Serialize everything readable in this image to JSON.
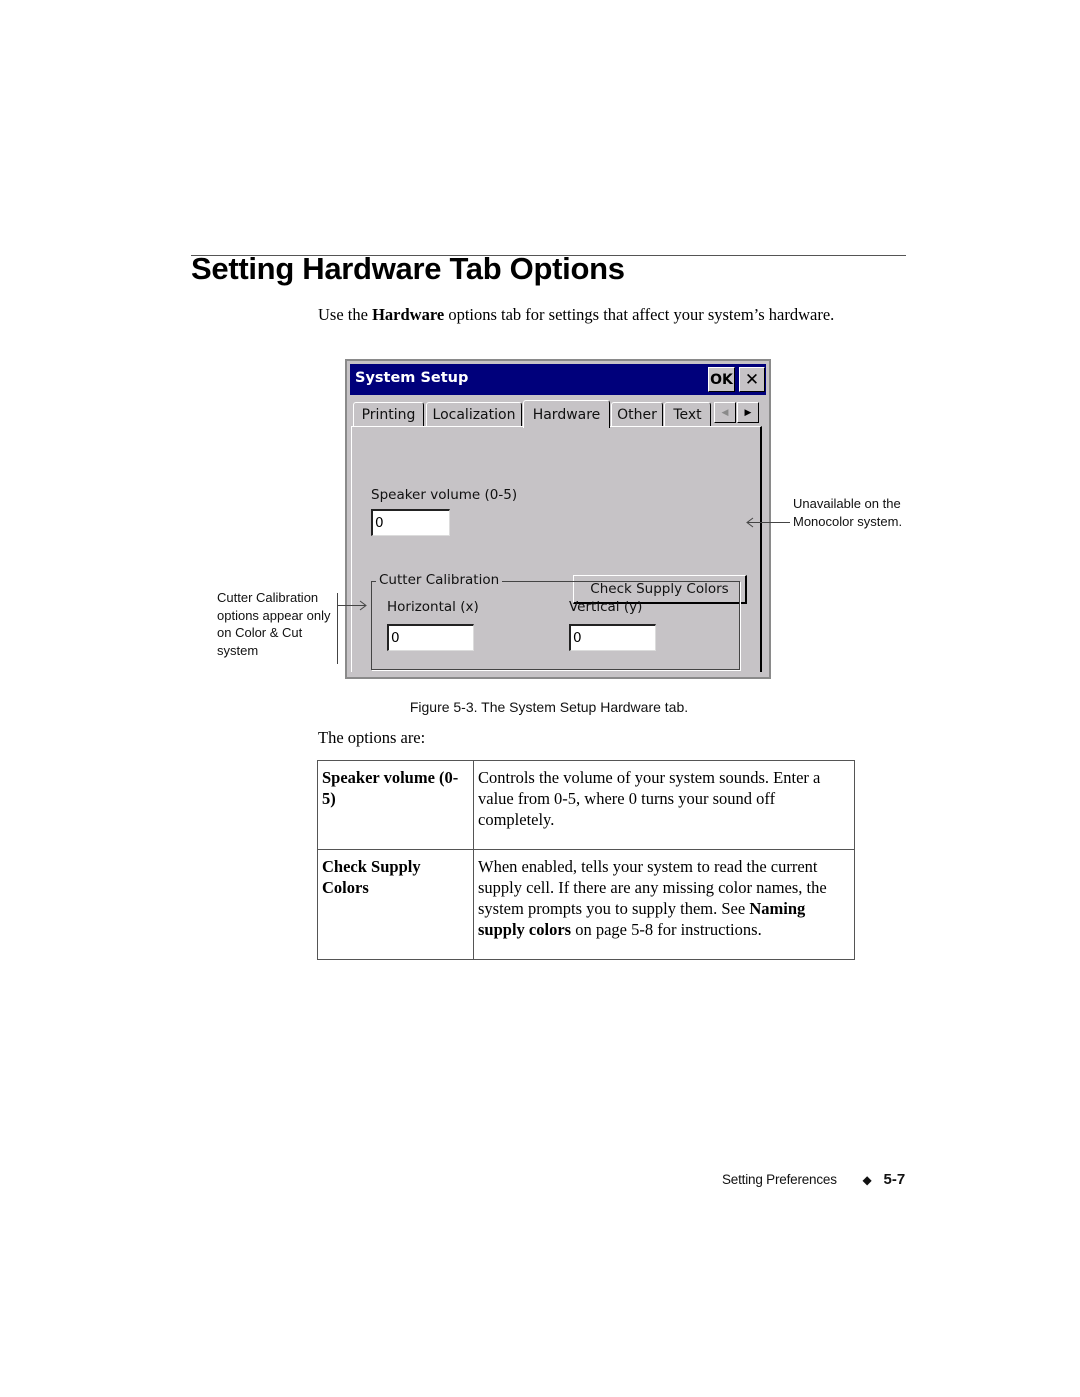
{
  "page": {
    "title": "Setting Hardware Tab Options",
    "intro_before": "Use the ",
    "intro_bold": "Hardware",
    "intro_after": " options tab for settings that affect your system’s hardware."
  },
  "window": {
    "title": "System Setup",
    "ok_label": "OK",
    "close_glyph": "✕",
    "tabs": [
      {
        "label": "Printing",
        "active": false
      },
      {
        "label": "Localization",
        "active": false
      },
      {
        "label": "Hardware",
        "active": true
      },
      {
        "label": "Other",
        "active": false
      },
      {
        "label": "Text",
        "active": false
      }
    ],
    "scroll_left_glyph": "◀",
    "scroll_right_glyph": "▶",
    "speaker_volume": {
      "label": "Speaker volume (0-5)",
      "value": "0"
    },
    "check_supply_colors_label": "Check Supply Colors",
    "cutter_calibration": {
      "legend": "Cutter Calibration",
      "horizontal": {
        "label": "Horizontal (x)",
        "value": "0"
      },
      "vertical": {
        "label": "Vertical (y)",
        "value": "0"
      }
    }
  },
  "callouts": {
    "left": "Cutter Calibration options appear only on Color & Cut system",
    "right": "Unavailable on the Monocolor system."
  },
  "figure_caption": "Figure 5-3. The System Setup Hardware tab.",
  "options_intro": "The options are:",
  "options": [
    {
      "term": "Speaker volume (0-5)",
      "desc_before": "Controls the volume of your system sounds. Enter a value from 0-5, where 0 turns your sound off completely.",
      "desc_bold": "",
      "desc_after": ""
    },
    {
      "term": "Check Supply Colors",
      "desc_before": "When enabled, tells your system to read the current supply cell. If there are any missing color names, the system prompts you to supply them. See ",
      "desc_bold": "Naming supply colors",
      "desc_after": " on page 5-8 for instructions."
    }
  ],
  "footer": {
    "section": "Setting Preferences",
    "diamond_glyph": "◆",
    "page_number": "5-7"
  }
}
